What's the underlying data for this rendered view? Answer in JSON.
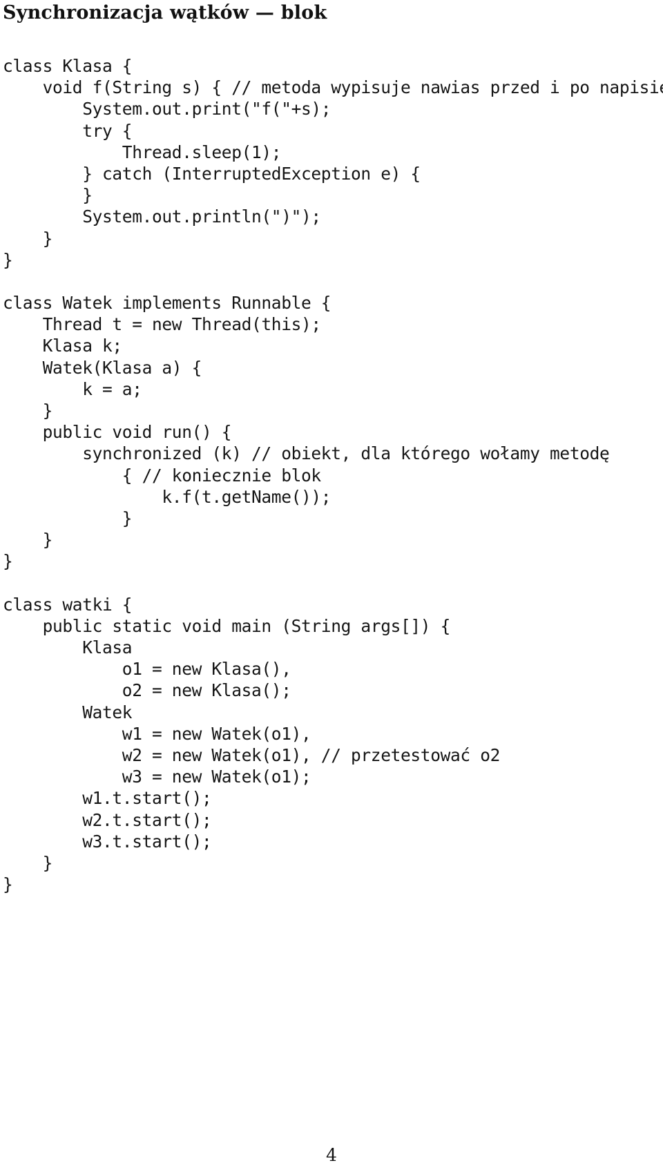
{
  "document": {
    "title": "Synchronizacja wątków — blok",
    "page_number": "4",
    "language": "pl"
  },
  "code_listing": {
    "language": "java",
    "lines": [
      "class Klasa {",
      "    void f(String s) { // metoda wypisuje nawias przed i po napisie",
      "        System.out.print(\"f(\"+s);",
      "        try {",
      "            Thread.sleep(1);",
      "        } catch (InterruptedException e) {",
      "        }",
      "        System.out.println(\")\");",
      "    }",
      "}",
      "",
      "class Watek implements Runnable {",
      "    Thread t = new Thread(this);",
      "    Klasa k;",
      "    Watek(Klasa a) {",
      "        k = a;",
      "    }",
      "    public void run() {",
      "        synchronized (k) // obiekt, dla którego wołamy metodę",
      "            { // koniecznie blok",
      "                k.f(t.getName());",
      "            }",
      "    }",
      "}",
      "",
      "class watki {",
      "    public static void main (String args[]) {",
      "        Klasa",
      "            o1 = new Klasa(),",
      "            o2 = new Klasa();",
      "        Watek",
      "            w1 = new Watek(o1),",
      "            w2 = new Watek(o1), // przetestować o2",
      "            w3 = new Watek(o1);",
      "        w1.t.start();",
      "        w2.t.start();",
      "        w3.t.start();",
      "    }",
      "}"
    ]
  },
  "colors": {
    "background": "#ffffff",
    "text": "#000000",
    "code_text": "#151515"
  }
}
